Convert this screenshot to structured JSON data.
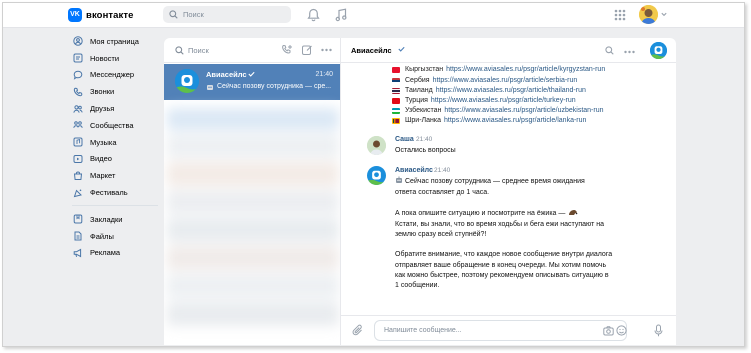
{
  "topbar": {
    "logo_text": "вконтакте",
    "logo_mark": "VK",
    "search_placeholder": "Поиск",
    "icons": [
      "bell-icon",
      "music-icon",
      "apps-grid-icon",
      "avatar",
      "chevron-down-icon"
    ]
  },
  "sidebar": {
    "items": [
      {
        "label": "Моя страница",
        "icon": "user-icon"
      },
      {
        "label": "Новости",
        "icon": "news-icon"
      },
      {
        "label": "Мессенджер",
        "icon": "chat-icon"
      },
      {
        "label": "Звонки",
        "icon": "phone-icon"
      },
      {
        "label": "Друзья",
        "icon": "friends-icon"
      },
      {
        "label": "Сообщества",
        "icon": "communities-icon"
      },
      {
        "label": "Музыка",
        "icon": "music-icon"
      },
      {
        "label": "Видео",
        "icon": "video-icon"
      },
      {
        "label": "Маркет",
        "icon": "market-icon"
      },
      {
        "label": "Фестиваль",
        "icon": "festival-icon"
      }
    ],
    "secondary": [
      {
        "label": "Закладки",
        "icon": "bookmark-icon"
      },
      {
        "label": "Файлы",
        "icon": "file-icon"
      },
      {
        "label": "Реклама",
        "icon": "ads-icon"
      }
    ]
  },
  "chat_list": {
    "search_placeholder": "Поиск",
    "active_chat": {
      "name": "Авиасейлс",
      "time": "21:40",
      "preview": "Сейчас позову сотрудника — сре..."
    }
  },
  "chat": {
    "title": "Авиасейлс",
    "countries": [
      {
        "name": "Кыргызстан",
        "link": "https://www.aviasales.ru/psgr/article/kyrgyzstan-run",
        "flag_color": "#e8112d"
      },
      {
        "name": "Сербия",
        "link": "https://www.aviasales.ru/psgr/article/serbia-run",
        "flag_color": "#c6363c"
      },
      {
        "name": "Таиланд",
        "link": "https://www.aviasales.ru/psgr/article/thailand-run",
        "flag_color": "#2d2a4a"
      },
      {
        "name": "Турция",
        "link": "https://www.aviasales.ru/psgr/article/turkey-run",
        "flag_color": "#e30a17"
      },
      {
        "name": "Узбекистан",
        "link": "https://www.aviasales.ru/psgr/article/uzbekistan-run",
        "flag_color": "#1eb53a"
      },
      {
        "name": "Шри-Ланка",
        "link": "https://www.aviasales.ru/psgr/article/lanka-run",
        "flag_color": "#ffb700"
      }
    ],
    "messages": [
      {
        "author": "Саша",
        "time": "21:40",
        "lines": [
          "Остались вопросы"
        ]
      },
      {
        "author": "Авиасейлс",
        "time": "21:40",
        "lines": [
          "Сейчас позову сотрудника — среднее время ожидания",
          "ответа составляет до 1 часа.",
          "",
          "А пока опишите ситуацию и посмотрите на ёжика —",
          "Кстати, вы знали, что во время ходьбы и бега ежи наступают на",
          "землю сразу всей ступнёй?!",
          "",
          "Обратите внимание, что каждое новое сообщение внутри диалога",
          "отправляет ваше обращение в конец очереди. Мы хотим помочь",
          "как можно быстрее, поэтому рекомендуем описывать ситуацию в",
          "1 сообщении."
        ]
      }
    ],
    "composer_placeholder": "Напишите сообщение..."
  },
  "colors": {
    "accent": "#0077ff",
    "active_row": "#5181b8",
    "link": "#2a5885",
    "page_bg": "#edeef0"
  }
}
